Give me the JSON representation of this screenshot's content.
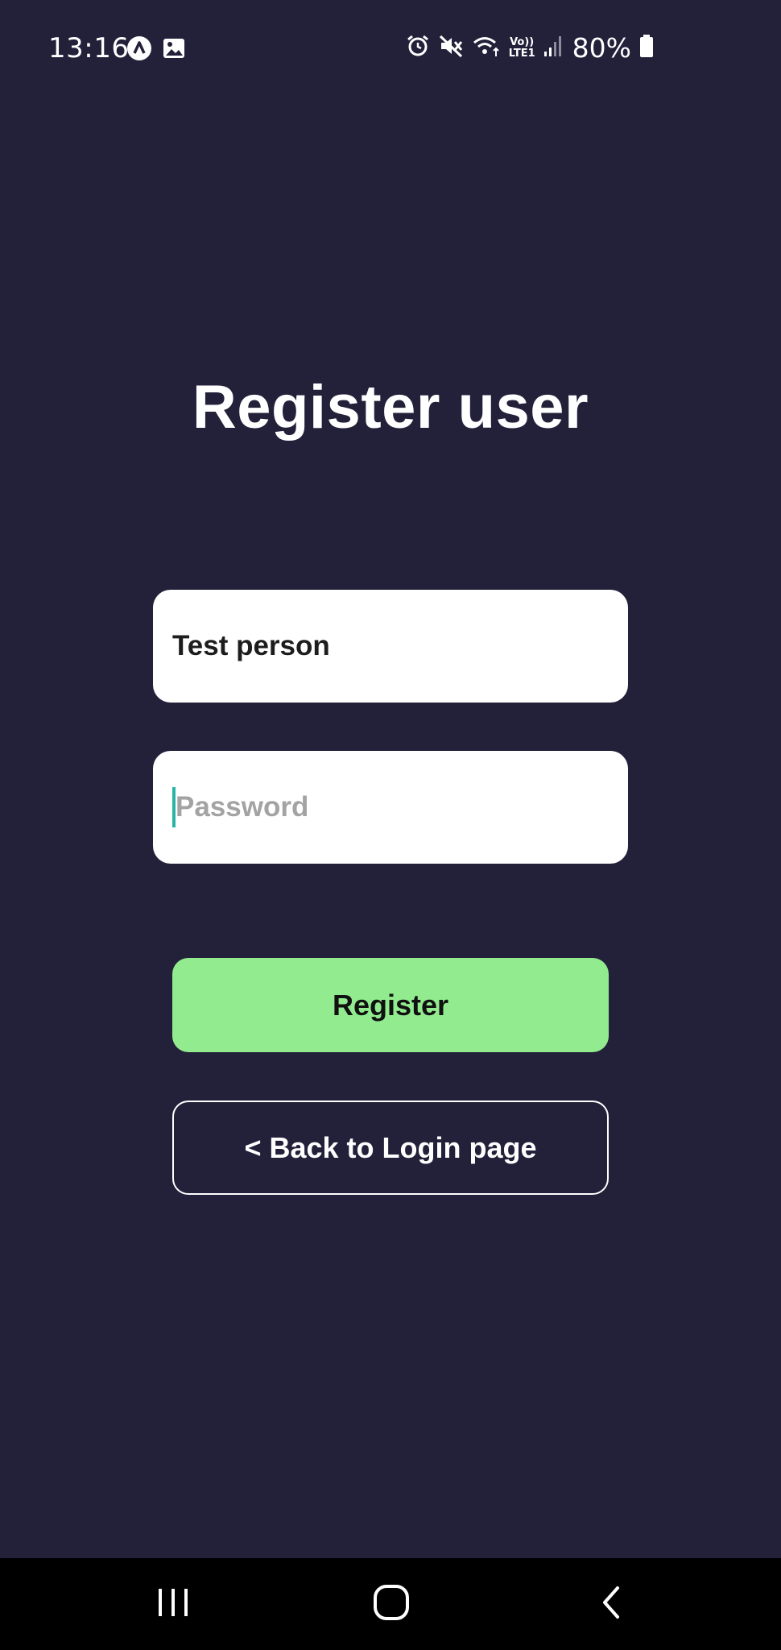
{
  "status_bar": {
    "time": "13:16",
    "lte_top": "Vo))",
    "lte_bottom": "LTE1",
    "battery_percent": "80%",
    "icons": [
      "app-a-icon",
      "gallery-icon",
      "alarm-icon",
      "mute-icon",
      "wifi-icon",
      "volte-lte-icon",
      "signal-icon",
      "battery-icon"
    ]
  },
  "main": {
    "title": "Register user",
    "username": {
      "value": "Test person"
    },
    "password": {
      "placeholder": "Password"
    },
    "register_button": "Register",
    "back_button": "< Back to Login page"
  },
  "nav_bar": {
    "buttons": [
      "recent-apps-icon",
      "home-icon",
      "back-icon"
    ]
  },
  "colors": {
    "background": "#23203a",
    "register_button": "#92ec8f",
    "caret": "#29b5a5",
    "field_background": "#ffffff"
  }
}
